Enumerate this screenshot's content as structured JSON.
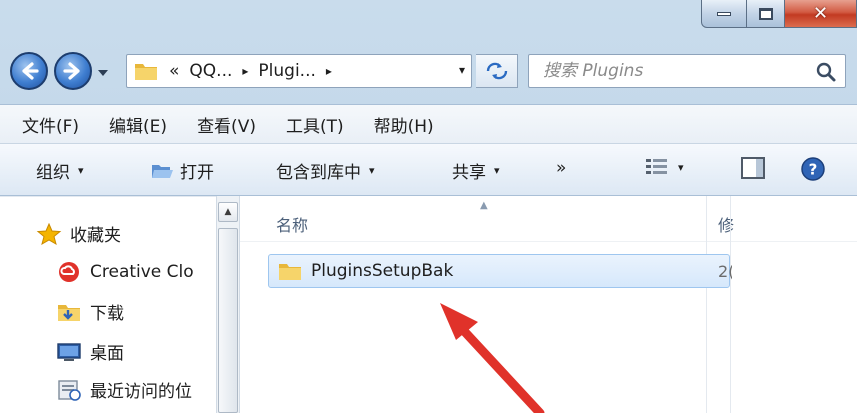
{
  "window": {
    "caption_close_glyph": "✕"
  },
  "address": {
    "overflow_marker": "«",
    "crumbs": [
      "QQ...",
      "Plugi..."
    ],
    "separator": "▸",
    "dropdown": "▾"
  },
  "search": {
    "placeholder": "搜索 Plugins"
  },
  "menu": {
    "items": [
      "文件(F)",
      "编辑(E)",
      "查看(V)",
      "工具(T)",
      "帮助(H)"
    ]
  },
  "commands": {
    "organize": "组织",
    "open": "打开",
    "include_in_library": "包含到库中",
    "share": "共享",
    "more": "»",
    "caret": "▾"
  },
  "nav_pane": {
    "favorites": "收藏夹",
    "items": [
      "Creative Clo",
      "下载",
      "桌面",
      "最近访问的位"
    ]
  },
  "columns": {
    "name": "名称",
    "date_partial": "修"
  },
  "files": [
    {
      "name": "PluginsSetupBak",
      "date_partial": "2("
    }
  ],
  "colors": {
    "accent_red": "#e0322a",
    "selection_border": "#9ec6ef",
    "folder_yellow": "#f2c94c"
  }
}
